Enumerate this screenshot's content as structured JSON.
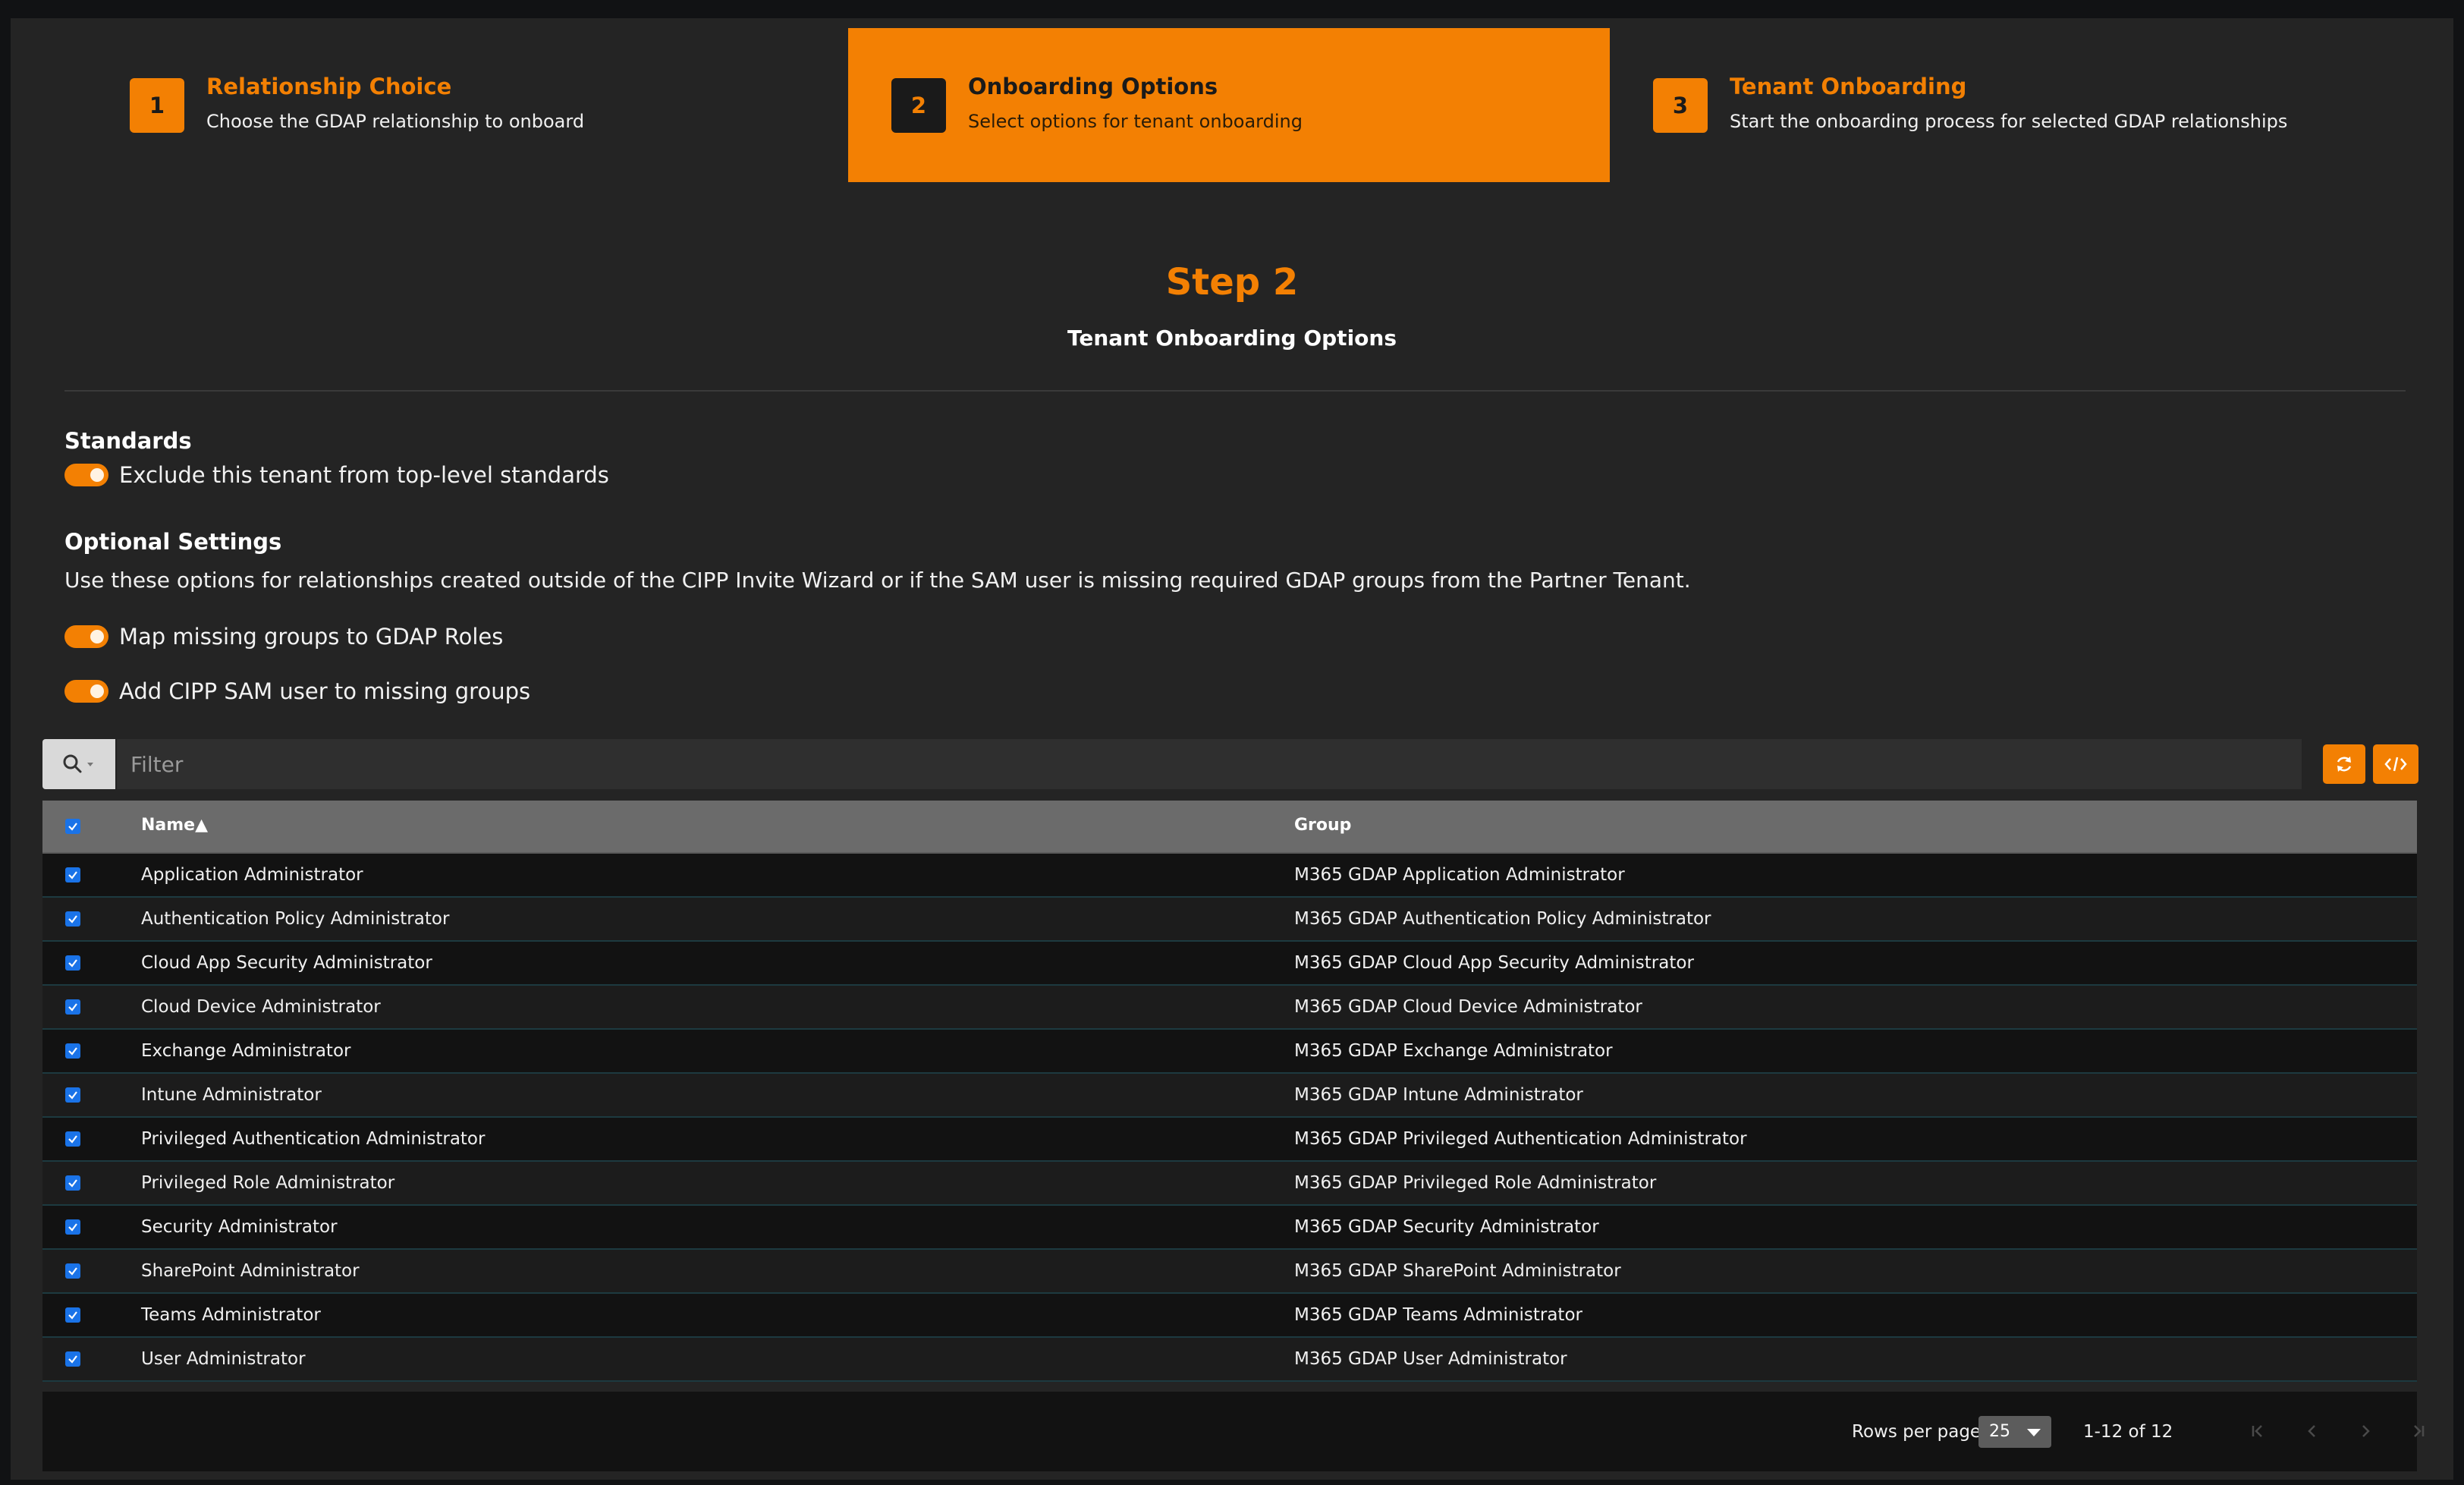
{
  "steps": [
    {
      "number": "1",
      "title": "Relationship Choice",
      "subtitle": "Choose the GDAP relationship to onboard",
      "active": false
    },
    {
      "number": "2",
      "title": "Onboarding Options",
      "subtitle": "Select options for tenant onboarding",
      "active": true
    },
    {
      "number": "3",
      "title": "Tenant Onboarding",
      "subtitle": "Start the onboarding process for selected GDAP relationships",
      "active": false
    }
  ],
  "heading": {
    "step": "Step 2",
    "subtitle": "Tenant Onboarding Options"
  },
  "standards": {
    "title": "Standards",
    "exclude_label": "Exclude this tenant from top-level standards",
    "exclude_on": true
  },
  "optional": {
    "title": "Optional Settings",
    "description": "Use these options for relationships created outside of the CIPP Invite Wizard or if the SAM user is missing required GDAP groups from the Partner Tenant.",
    "map_label": "Map missing groups to GDAP Roles",
    "map_on": true,
    "add_sam_label": "Add CIPP SAM user to missing groups",
    "add_sam_on": true
  },
  "filter": {
    "placeholder": "Filter",
    "value": ""
  },
  "table": {
    "columns": {
      "name": "Name",
      "group": "Group",
      "sort_indicator": "▲"
    },
    "rows": [
      {
        "name": "Application Administrator",
        "group": "M365 GDAP Application Administrator",
        "checked": true
      },
      {
        "name": "Authentication Policy Administrator",
        "group": "M365 GDAP Authentication Policy Administrator",
        "checked": true
      },
      {
        "name": "Cloud App Security Administrator",
        "group": "M365 GDAP Cloud App Security Administrator",
        "checked": true
      },
      {
        "name": "Cloud Device Administrator",
        "group": "M365 GDAP Cloud Device Administrator",
        "checked": true
      },
      {
        "name": "Exchange Administrator",
        "group": "M365 GDAP Exchange Administrator",
        "checked": true
      },
      {
        "name": "Intune Administrator",
        "group": "M365 GDAP Intune Administrator",
        "checked": true
      },
      {
        "name": "Privileged Authentication Administrator",
        "group": "M365 GDAP Privileged Authentication Administrator",
        "checked": true
      },
      {
        "name": "Privileged Role Administrator",
        "group": "M365 GDAP Privileged Role Administrator",
        "checked": true
      },
      {
        "name": "Security Administrator",
        "group": "M365 GDAP Security Administrator",
        "checked": true
      },
      {
        "name": "SharePoint Administrator",
        "group": "M365 GDAP SharePoint Administrator",
        "checked": true
      },
      {
        "name": "Teams Administrator",
        "group": "M365 GDAP Teams Administrator",
        "checked": true
      },
      {
        "name": "User Administrator",
        "group": "M365 GDAP User Administrator",
        "checked": true
      }
    ]
  },
  "pagination": {
    "rows_per_page_label": "Rows per page:",
    "rows_per_page": "25",
    "range": "1-12 of 12"
  },
  "colors": {
    "accent": "#f38003",
    "checkbox": "#1a73e8",
    "background": "#242424"
  },
  "icons": [
    "search-icon",
    "dropdown-caret-icon",
    "refresh-icon",
    "code-icon",
    "first-page-icon",
    "prev-page-icon",
    "next-page-icon",
    "last-page-icon"
  ]
}
